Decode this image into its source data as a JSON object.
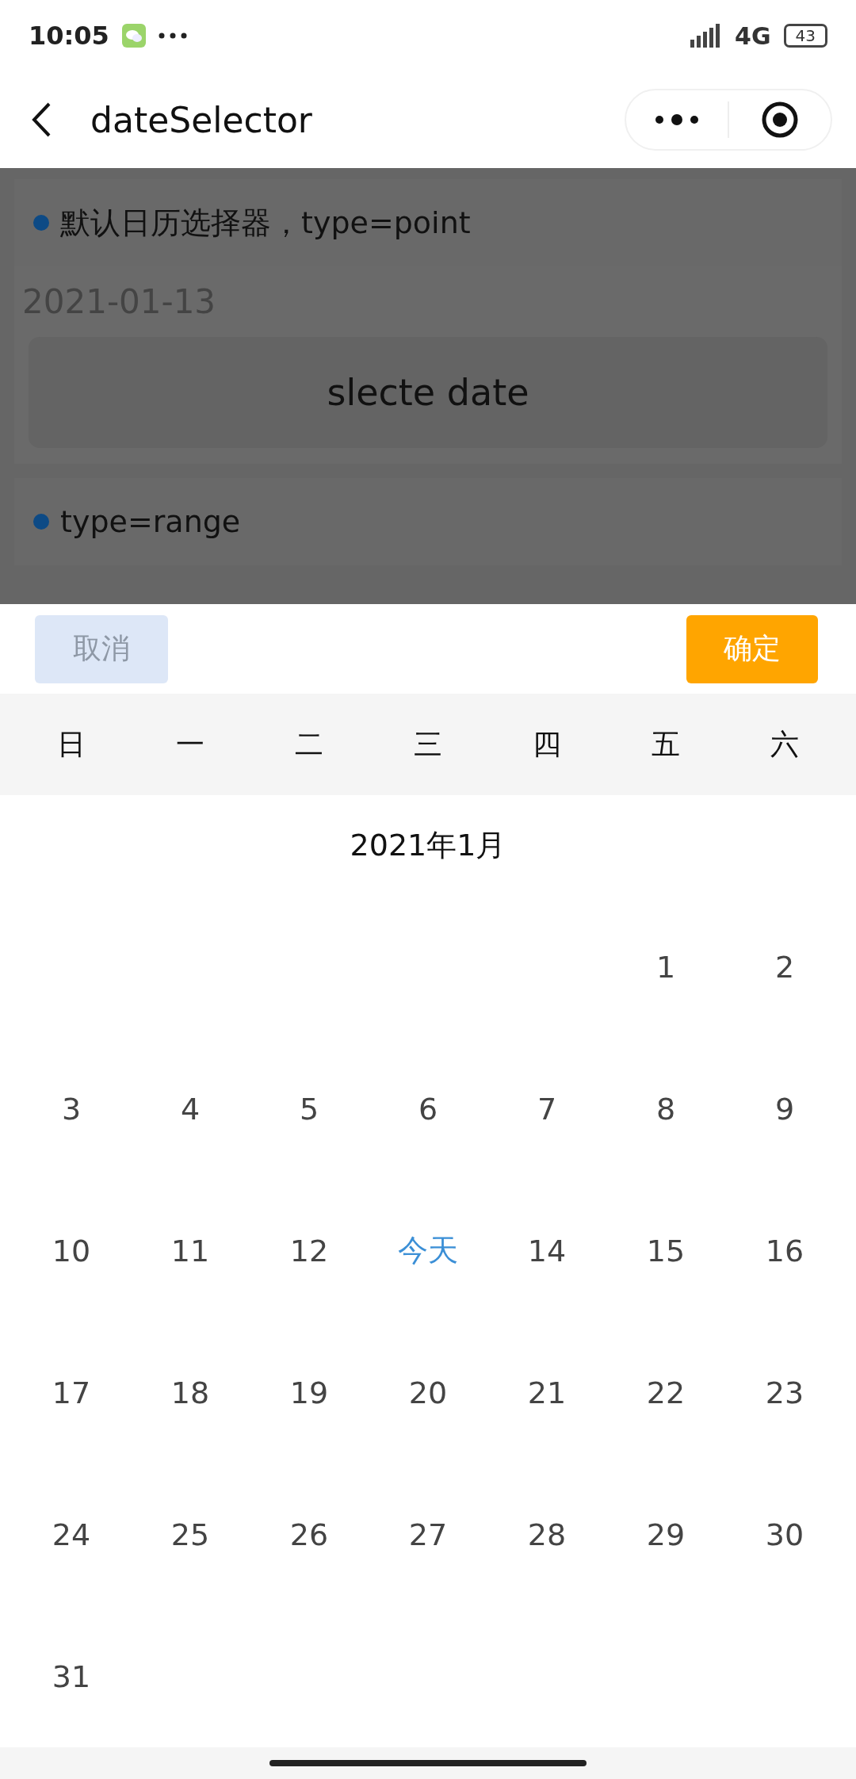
{
  "status_bar": {
    "time": "10:05",
    "network": "4G",
    "battery": "43"
  },
  "nav": {
    "title": "dateSelector"
  },
  "page": {
    "sections": [
      {
        "title": "默认日历选择器，type=point",
        "value": "2021-01-13",
        "button": "slecte date"
      },
      {
        "title": "type=range"
      }
    ]
  },
  "picker": {
    "cancel": "取消",
    "confirm": "确定",
    "weekdays": [
      "日",
      "一",
      "二",
      "三",
      "四",
      "五",
      "六"
    ],
    "month": "2021年1月",
    "weeks": [
      {
        "kind": "first",
        "days": [
          {
            "label": "1",
            "today": false
          },
          {
            "label": "2",
            "today": false
          }
        ]
      },
      {
        "kind": "full",
        "days": [
          {
            "label": "3",
            "today": false
          },
          {
            "label": "4",
            "today": false
          },
          {
            "label": "5",
            "today": false
          },
          {
            "label": "6",
            "today": false
          },
          {
            "label": "7",
            "today": false
          },
          {
            "label": "8",
            "today": false
          },
          {
            "label": "9",
            "today": false
          }
        ]
      },
      {
        "kind": "full",
        "days": [
          {
            "label": "10",
            "today": false
          },
          {
            "label": "11",
            "today": false
          },
          {
            "label": "12",
            "today": false
          },
          {
            "label": "今天",
            "today": true
          },
          {
            "label": "14",
            "today": false
          },
          {
            "label": "15",
            "today": false
          },
          {
            "label": "16",
            "today": false
          }
        ]
      },
      {
        "kind": "full",
        "days": [
          {
            "label": "17",
            "today": false
          },
          {
            "label": "18",
            "today": false
          },
          {
            "label": "19",
            "today": false
          },
          {
            "label": "20",
            "today": false
          },
          {
            "label": "21",
            "today": false
          },
          {
            "label": "22",
            "today": false
          },
          {
            "label": "23",
            "today": false
          }
        ]
      },
      {
        "kind": "full",
        "days": [
          {
            "label": "24",
            "today": false
          },
          {
            "label": "25",
            "today": false
          },
          {
            "label": "26",
            "today": false
          },
          {
            "label": "27",
            "today": false
          },
          {
            "label": "28",
            "today": false
          },
          {
            "label": "29",
            "today": false
          },
          {
            "label": "30",
            "today": false
          }
        ]
      },
      {
        "kind": "last",
        "days": [
          {
            "label": "31",
            "today": false
          }
        ]
      }
    ]
  }
}
